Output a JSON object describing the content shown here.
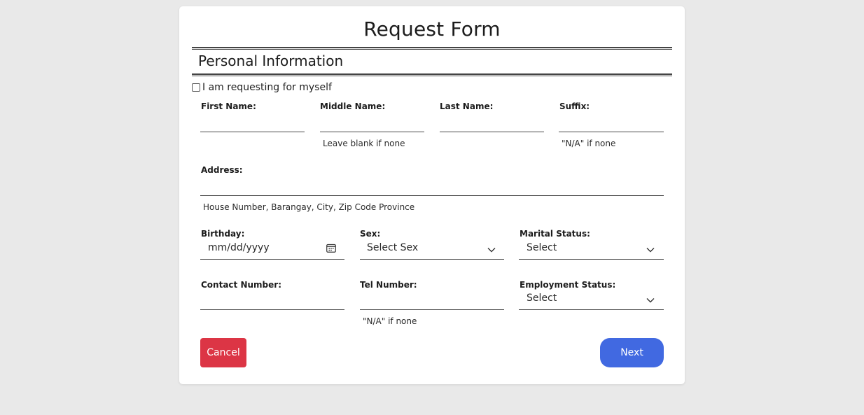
{
  "form": {
    "title": "Request Form",
    "section_title": "Personal Information",
    "myself_checkbox": {
      "label": "I am requesting for myself",
      "checked": false
    },
    "name_fields": {
      "first_name": {
        "label": "First Name:",
        "value": ""
      },
      "middle_name": {
        "label": "Middle Name:",
        "value": "",
        "hint": "Leave blank if none"
      },
      "last_name": {
        "label": "Last Name:",
        "value": ""
      },
      "suffix": {
        "label": "Suffix:",
        "value": "",
        "hint": "\"N/A\" if none"
      }
    },
    "address": {
      "label": "Address:",
      "value": "",
      "hint": "House Number, Barangay, City, Zip Code Province"
    },
    "birthday": {
      "label": "Birthday:",
      "placeholder": "mm/dd/yyyy",
      "icon": "calendar-icon"
    },
    "sex": {
      "label": "Sex:",
      "selected": "Select Sex",
      "icon": "chevron-down-icon"
    },
    "marital_status": {
      "label": "Marital Status:",
      "selected": "Select",
      "icon": "chevron-down-icon"
    },
    "contact_number": {
      "label": "Contact Number:",
      "value": ""
    },
    "tel_number": {
      "label": "Tel Number:",
      "value": "",
      "hint": "\"N/A\" if none"
    },
    "employment_status": {
      "label": "Employment Status:",
      "selected": "Select",
      "icon": "chevron-down-icon"
    },
    "buttons": {
      "cancel": "Cancel",
      "next": "Next"
    }
  },
  "colors": {
    "page_background": "#e9e9e9",
    "card_background": "#ffffff",
    "cancel_button": "#dc3545",
    "next_button": "#4169e1",
    "rule": "#444444"
  }
}
